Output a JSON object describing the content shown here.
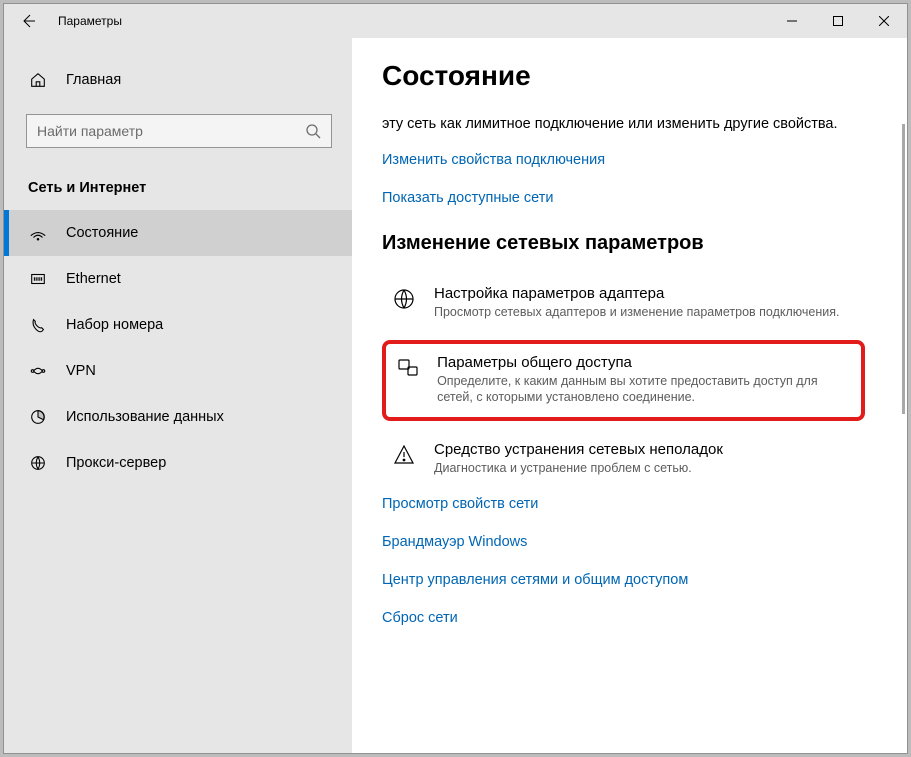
{
  "window": {
    "title": "Параметры"
  },
  "sidebar": {
    "home": "Главная",
    "search_placeholder": "Найти параметр",
    "category": "Сеть и Интернет",
    "items": [
      {
        "label": "Состояние"
      },
      {
        "label": "Ethernet"
      },
      {
        "label": "Набор номера"
      },
      {
        "label": "VPN"
      },
      {
        "label": "Использование данных"
      },
      {
        "label": "Прокси-сервер"
      }
    ]
  },
  "main": {
    "page_title": "Состояние",
    "intro_text": "эту сеть как лимитное подключение или изменить другие свойства.",
    "links_top": [
      "Изменить свойства подключения",
      "Показать доступные сети"
    ],
    "section_heading": "Изменение сетевых параметров",
    "items": [
      {
        "title": "Настройка параметров адаптера",
        "desc": "Просмотр сетевых адаптеров и изменение параметров подключения."
      },
      {
        "title": "Параметры общего доступа",
        "desc": "Определите, к каким данным вы хотите предоставить доступ для сетей, с которыми установлено соединение."
      },
      {
        "title": "Средство устранения сетевых неполадок",
        "desc": "Диагностика и устранение проблем с сетью."
      }
    ],
    "links_bottom": [
      "Просмотр свойств сети",
      "Брандмауэр Windows",
      "Центр управления сетями и общим доступом",
      "Сброс сети"
    ]
  }
}
